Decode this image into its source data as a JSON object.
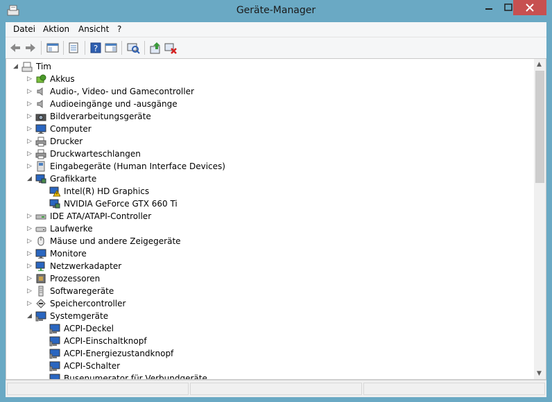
{
  "window": {
    "title": "Geräte-Manager",
    "accent": "#6aa9c4",
    "close_color": "#c75050"
  },
  "menu": [
    "Datei",
    "Aktion",
    "Ansicht",
    "?"
  ],
  "toolbar": [
    "back-icon",
    "forward-icon",
    "show-hide-console-tree-icon",
    "properties-icon",
    "help-icon",
    "action-pane-icon",
    "scan-hardware-icon",
    "update-driver-icon",
    "disable-device-icon"
  ],
  "tree": {
    "root": "Tim",
    "items": [
      {
        "label": "Akkus",
        "icon": "battery-icon"
      },
      {
        "label": "Audio-, Video- und Gamecontroller",
        "icon": "speaker-icon"
      },
      {
        "label": "Audioeingänge und -ausgänge",
        "icon": "speaker-icon"
      },
      {
        "label": "Bildverarbeitungsgeräte",
        "icon": "camera-icon"
      },
      {
        "label": "Computer",
        "icon": "monitor-icon"
      },
      {
        "label": "Drucker",
        "icon": "printer-icon"
      },
      {
        "label": "Druckwarteschlangen",
        "icon": "printer-icon"
      },
      {
        "label": "Eingabegeräte (Human Interface Devices)",
        "icon": "hid-icon"
      },
      {
        "label": "Grafikkarte",
        "icon": "display-adapter-icon",
        "expanded": true,
        "children": [
          {
            "label": "Intel(R) HD Graphics",
            "icon": "display-adapter-warning-icon"
          },
          {
            "label": "NVIDIA GeForce GTX 660 Ti",
            "icon": "display-adapter-icon"
          }
        ]
      },
      {
        "label": "IDE ATA/ATAPI-Controller",
        "icon": "ide-controller-icon"
      },
      {
        "label": "Laufwerke",
        "icon": "disk-drive-icon"
      },
      {
        "label": "Mäuse und andere Zeigegeräte",
        "icon": "mouse-icon"
      },
      {
        "label": "Monitore",
        "icon": "monitor-icon"
      },
      {
        "label": "Netzwerkadapter",
        "icon": "network-adapter-icon"
      },
      {
        "label": "Prozessoren",
        "icon": "processor-icon"
      },
      {
        "label": "Softwaregeräte",
        "icon": "software-device-icon"
      },
      {
        "label": "Speichercontroller",
        "icon": "storage-controller-icon"
      },
      {
        "label": "Systemgeräte",
        "icon": "system-device-icon",
        "expanded": true,
        "children": [
          {
            "label": "ACPI-Deckel",
            "icon": "system-device-icon"
          },
          {
            "label": "ACPI-Einschaltknopf",
            "icon": "system-device-icon"
          },
          {
            "label": "ACPI-Energiezustandknopf",
            "icon": "system-device-icon"
          },
          {
            "label": "ACPI-Schalter",
            "icon": "system-device-icon"
          },
          {
            "label": "Busenumerator für Verbundgeräte",
            "icon": "system-device-icon"
          }
        ]
      }
    ]
  }
}
